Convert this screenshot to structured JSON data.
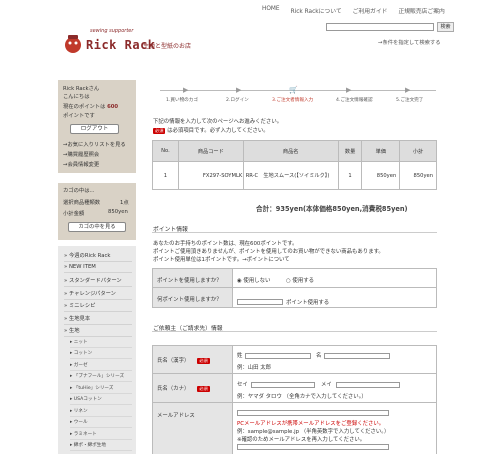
{
  "topnav": [
    "HOME",
    "Rick Rackについて",
    "ご利用ガイド",
    "正規販売店ご案内"
  ],
  "search": {
    "button": "検索",
    "advanced": "→条件を指定して検索する"
  },
  "logo": {
    "sub": "sewing supporter",
    "main": "Rick Rack",
    "tag": "生地と型紙のお店"
  },
  "user_box": {
    "name": "Rick Rackさん",
    "hello": "こんにちは",
    "points_pre": "現在のポイントは ",
    "points_val": "600",
    "points_unit": "ポイントです",
    "logout": "ログアウト",
    "links": [
      "→お気に入りリストを見る",
      "→購買履歴照会",
      "→会員情報変更"
    ]
  },
  "cart_box": {
    "title": "カゴの中は...",
    "count_label": "選択商品種類数",
    "count": "1点",
    "subtotal_label": "小計金額",
    "subtotal": "850yen",
    "button": "カゴの中を見る"
  },
  "categories": [
    {
      "label": "今週のRick Rack",
      "sub": false
    },
    {
      "label": "NEW ITEM",
      "sub": false
    },
    {
      "label": "スタンダードパターン",
      "sub": false
    },
    {
      "label": "チャレンジパターン",
      "sub": false
    },
    {
      "label": "ミニレシピ",
      "sub": false
    },
    {
      "label": "生地見本",
      "sub": false
    },
    {
      "label": "生地",
      "sub": false
    },
    {
      "label": "ニット",
      "sub": true
    },
    {
      "label": "コットン",
      "sub": true
    },
    {
      "label": "ガーゼ",
      "sub": true
    },
    {
      "label": "「ブナフール」シリーズ",
      "sub": true
    },
    {
      "label": "「tuHie」シリーズ",
      "sub": true
    },
    {
      "label": "USAコットン",
      "sub": true
    },
    {
      "label": "リネン",
      "sub": true
    },
    {
      "label": "ウール",
      "sub": true
    },
    {
      "label": "ラミネート",
      "sub": true
    },
    {
      "label": "綿ポ・綿ポ生地",
      "sub": true
    }
  ],
  "steps": [
    "1.買い物のカゴ",
    "2.ログイン",
    "3.ご注文者情報入力",
    "4.ご注文情報確認",
    "5.ご注文完了"
  ],
  "intro": {
    "line1": "下記の情報を入力して次のページへお進みください。",
    "req_badge": "必須",
    "line2": "は必須項目です。必ず入力してください。"
  },
  "cart_table": {
    "headers": [
      "No.",
      "商品コード",
      "商品名",
      "数量",
      "単価",
      "小計"
    ],
    "rows": [
      [
        "1",
        "FX297-SOYMLK",
        "RR-C　生地スムース(【ソイミルク】)",
        "1",
        "850yen",
        "850yen"
      ]
    ]
  },
  "total": "合計：935yen(本体価格850yen,消費税85yen)",
  "point": {
    "heading": "ポイント情報",
    "desc": [
      "あなたのお手持ちのポイント数は、現在600ポイントです。",
      "ポイントご使用頂きありませんが、ポイントを使用してのお買い物ができない商品もあります。",
      "ポイント使用単位は1ポイントです。→ポイントについて"
    ],
    "use_label": "ポイントを使用しますか？",
    "opt_no": "使用しない",
    "opt_yes": "使用する",
    "amount_label": "何ポイント使用しますか？",
    "amount_unit": "ポイント使用する"
  },
  "customer": {
    "heading": "ご依頼主（ご請求先）情報",
    "name_label": "氏名（漢字）",
    "req": "必須",
    "sei": "姓",
    "mei": "名",
    "name_ex": "例：山田 太郎",
    "kana_label": "氏名（カナ）",
    "sei_kana": "セイ",
    "mei_kana": "メイ",
    "kana_ex": "例：ヤマダ タロウ （全角カナで入力してください。）",
    "email_label": "メールアドレス",
    "email_warn": "PCメールアドレスが携帯メールアドレスをご登録ください。",
    "email_ex": "例：sample@sample.jp （半角英数字で入力してください。）",
    "email_confirm": "※確認のためメールアドレスを再入力してください。"
  },
  "colors": {
    "brand": "#8b2a2a",
    "sidebar": "#d9d2c6",
    "required": "#cc0000"
  }
}
